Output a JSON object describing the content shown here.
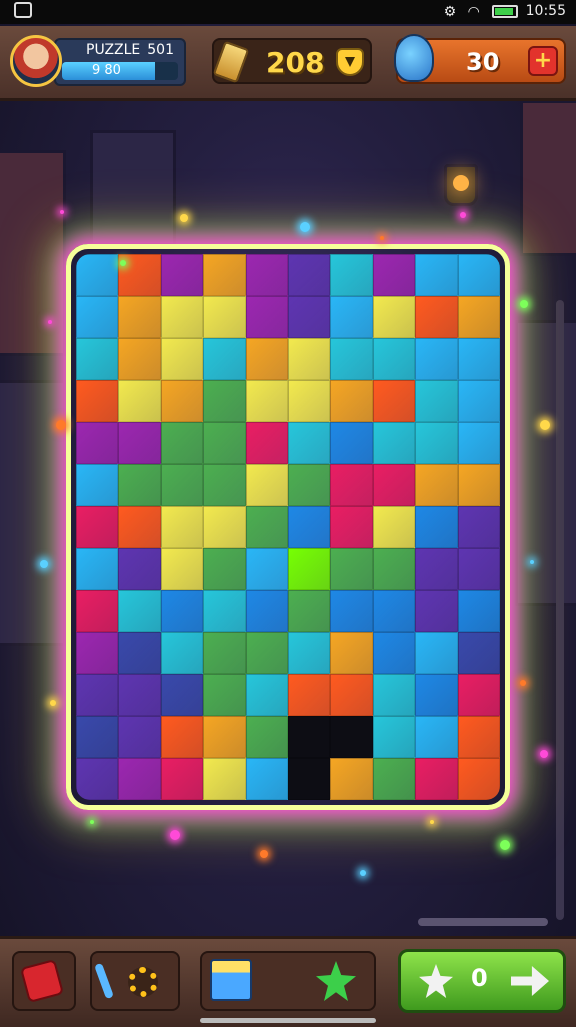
{
  "status_bar": {
    "time": "10:55"
  },
  "hud": {
    "player_name": "PUZZLE",
    "player_score": "501",
    "xp_text": "9 80",
    "xp_fraction": 0.8,
    "coins": "208",
    "lives": "30",
    "add_label": "+"
  },
  "board": {
    "palette": [
      "#f2e94e",
      "#f5a623",
      "#ff5a1f",
      "#e91e63",
      "#9c27b0",
      "#5e35b1",
      "#3949ab",
      "#1e88e5",
      "#29b6f6",
      "#26c6da",
      "#4caf50",
      "#76ff03"
    ],
    "rows": [
      [
        8,
        2,
        4,
        1,
        4,
        5,
        9,
        4,
        8,
        8
      ],
      [
        8,
        1,
        0,
        0,
        4,
        5,
        8,
        0,
        2,
        1
      ],
      [
        9,
        1,
        0,
        9,
        1,
        0,
        9,
        9,
        8,
        8
      ],
      [
        2,
        0,
        1,
        10,
        0,
        0,
        1,
        2,
        9,
        8
      ],
      [
        4,
        4,
        10,
        10,
        3,
        9,
        7,
        9,
        9,
        8
      ],
      [
        8,
        10,
        10,
        10,
        0,
        10,
        3,
        3,
        1,
        1
      ],
      [
        3,
        2,
        0,
        0,
        10,
        7,
        3,
        0,
        7,
        5
      ],
      [
        8,
        5,
        0,
        10,
        8,
        11,
        10,
        10,
        5,
        5
      ],
      [
        3,
        9,
        7,
        9,
        7,
        10,
        7,
        7,
        5,
        7
      ],
      [
        4,
        6,
        9,
        10,
        10,
        9,
        1,
        7,
        8,
        6
      ],
      [
        5,
        5,
        6,
        10,
        9,
        2,
        2,
        9,
        7,
        3
      ],
      [
        6,
        5,
        2,
        1,
        10,
        "x",
        "x",
        9,
        8,
        2
      ],
      [
        5,
        4,
        3,
        0,
        8,
        "x",
        1,
        10,
        3,
        2
      ]
    ]
  },
  "toolbar": {
    "play_count": "0"
  }
}
